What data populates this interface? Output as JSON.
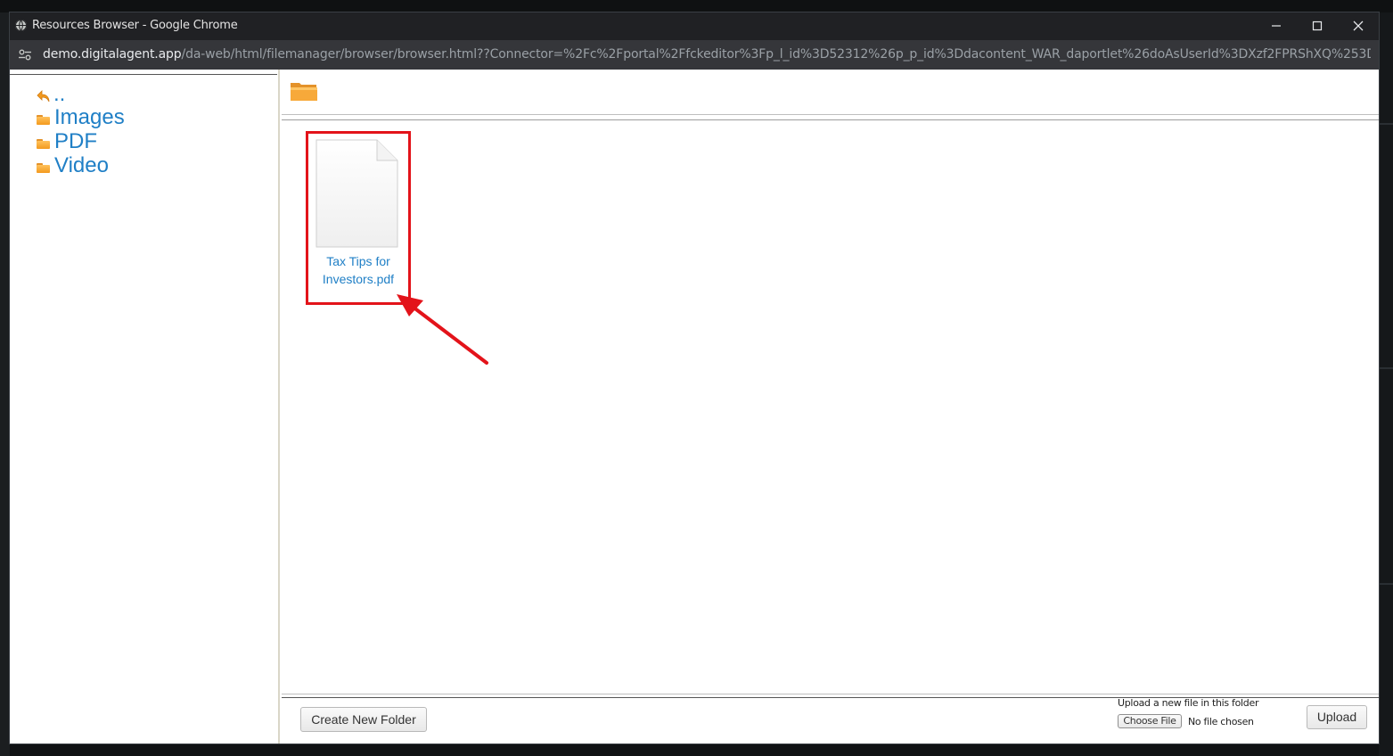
{
  "window": {
    "title": "Resources Browser - Google Chrome"
  },
  "address_bar": {
    "host": "demo.digitalagent.app",
    "path": "/da-web/html/filemanager/browser/browser.html??Connector=%2Fc%2Fportal%2Ffckeditor%3Fp_l_id%3D52312%26p_p_id%3Ddacontent_WAR_daportlet%26doAsUserId%3DXzf2FPRShXQ%253D%26doAsGroupId%…"
  },
  "folder_tree": {
    "items": [
      {
        "label": "..",
        "icon": "back-arrow-icon"
      },
      {
        "label": "Images",
        "icon": "folder-icon"
      },
      {
        "label": "PDF",
        "icon": "folder-icon"
      },
      {
        "label": "Video",
        "icon": "folder-icon"
      }
    ]
  },
  "files": [
    {
      "name_line1": "Tax Tips for",
      "name_line2": "Investors.pdf",
      "icon": "document-icon"
    }
  ],
  "bottom": {
    "create_folder_label": "Create New Folder",
    "upload_label": "Upload a new file in this folder",
    "choose_file_label": "Choose File",
    "no_file_text": "No file chosen",
    "upload_button_label": "Upload"
  },
  "colors": {
    "link": "#1f7fc6",
    "folder": "#f39a1e",
    "highlight": "#e3131a",
    "titlebar": "#202124"
  }
}
